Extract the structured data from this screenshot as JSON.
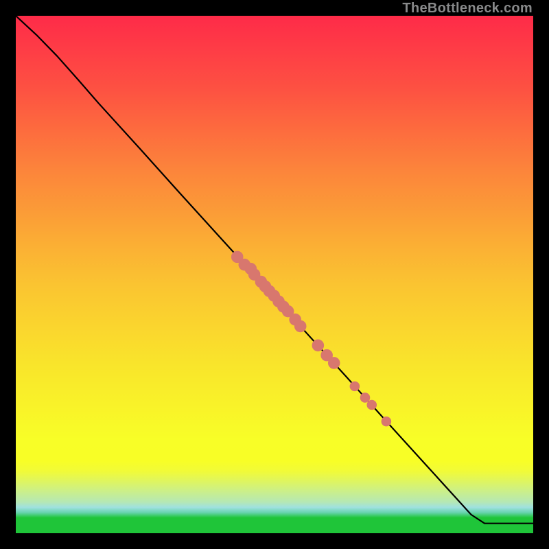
{
  "watermark": "TheBottleneck.com",
  "chart_data": {
    "type": "line",
    "title": "",
    "xlabel": "",
    "ylabel": "",
    "xlim": [
      0,
      100
    ],
    "ylim": [
      0,
      100
    ],
    "grid": false,
    "legend": false,
    "note": "Axes are unlabeled in the source image; data values are estimated from pixel positions mapped linearly to 0–100 on each axis.",
    "curve": [
      {
        "x": 0.0,
        "y": 100.0
      },
      {
        "x": 4.0,
        "y": 96.3
      },
      {
        "x": 8.0,
        "y": 92.2
      },
      {
        "x": 12.0,
        "y": 87.7
      },
      {
        "x": 16.0,
        "y": 83.1
      },
      {
        "x": 24.0,
        "y": 74.3
      },
      {
        "x": 32.0,
        "y": 65.4
      },
      {
        "x": 40.0,
        "y": 56.6
      },
      {
        "x": 48.0,
        "y": 47.8
      },
      {
        "x": 56.0,
        "y": 38.9
      },
      {
        "x": 64.0,
        "y": 30.1
      },
      {
        "x": 72.0,
        "y": 21.2
      },
      {
        "x": 80.0,
        "y": 12.4
      },
      {
        "x": 88.0,
        "y": 3.6
      },
      {
        "x": 90.6,
        "y": 1.9
      },
      {
        "x": 100.0,
        "y": 1.9
      }
    ],
    "points": [
      {
        "x": 42.8,
        "y": 53.4,
        "r": 1.1
      },
      {
        "x": 44.2,
        "y": 51.9,
        "r": 1.1
      },
      {
        "x": 45.4,
        "y": 51.1,
        "r": 1.1
      },
      {
        "x": 46.1,
        "y": 50.0,
        "r": 1.1
      },
      {
        "x": 47.4,
        "y": 48.6,
        "r": 1.1
      },
      {
        "x": 48.2,
        "y": 47.7,
        "r": 1.1
      },
      {
        "x": 49.0,
        "y": 46.8,
        "r": 1.1
      },
      {
        "x": 49.9,
        "y": 45.9,
        "r": 1.1
      },
      {
        "x": 50.8,
        "y": 44.8,
        "r": 1.1
      },
      {
        "x": 51.7,
        "y": 43.8,
        "r": 1.1
      },
      {
        "x": 52.6,
        "y": 42.9,
        "r": 1.1
      },
      {
        "x": 54.0,
        "y": 41.3,
        "r": 1.1
      },
      {
        "x": 55.0,
        "y": 40.0,
        "r": 1.1
      },
      {
        "x": 58.4,
        "y": 36.3,
        "r": 1.1
      },
      {
        "x": 60.1,
        "y": 34.4,
        "r": 1.1
      },
      {
        "x": 61.5,
        "y": 32.9,
        "r": 1.1
      },
      {
        "x": 65.5,
        "y": 28.4,
        "r": 0.9
      },
      {
        "x": 67.5,
        "y": 26.2,
        "r": 0.9
      },
      {
        "x": 68.8,
        "y": 24.8,
        "r": 0.9
      },
      {
        "x": 71.6,
        "y": 21.6,
        "r": 0.9
      }
    ]
  }
}
